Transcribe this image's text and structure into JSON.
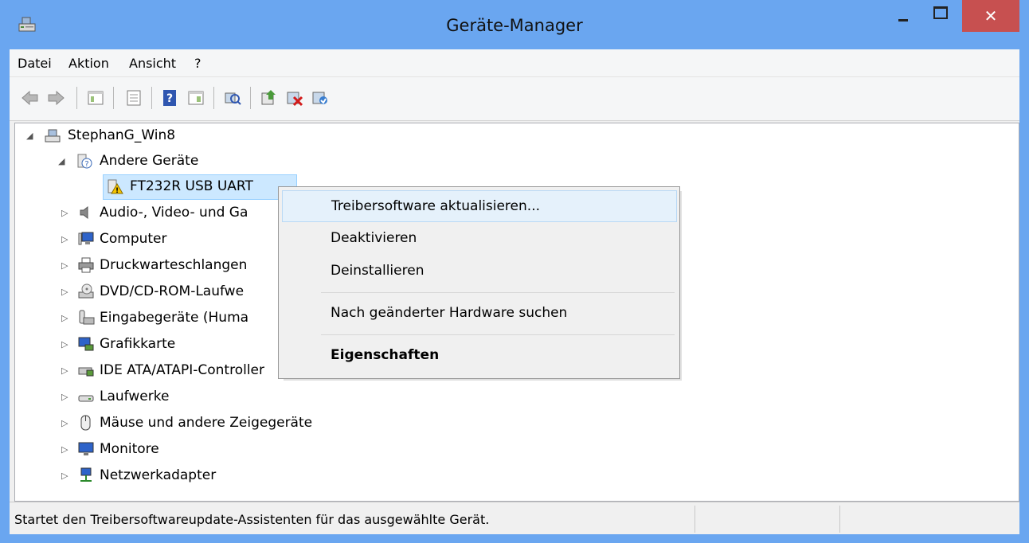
{
  "window": {
    "title": "Geräte-Manager",
    "minimize_glyph": "",
    "maximize_glyph": "",
    "close_glyph": "✕"
  },
  "menu": {
    "items": [
      "Datei",
      "Aktion",
      "Ansicht",
      "?"
    ]
  },
  "tree": {
    "root": "StephanG_Win8",
    "items": [
      {
        "label": "Andere Geräte",
        "icon": "unknown-device-icon",
        "expanded": true
      },
      {
        "label": "FT232R USB UART",
        "icon": "warning-device-icon",
        "selected": true
      },
      {
        "label": "Audio-, Video- und Ga",
        "icon": "speaker-icon"
      },
      {
        "label": "Computer",
        "icon": "computer-icon"
      },
      {
        "label": "Druckwarteschlangen",
        "icon": "printer-icon"
      },
      {
        "label": "DVD/CD-ROM-Laufwe",
        "icon": "dvd-drive-icon"
      },
      {
        "label": "Eingabegeräte (Huma",
        "icon": "input-device-icon"
      },
      {
        "label": "Grafikkarte",
        "icon": "display-adapter-icon"
      },
      {
        "label": "IDE ATA/ATAPI-Controller",
        "icon": "ide-controller-icon"
      },
      {
        "label": "Laufwerke",
        "icon": "disk-drive-icon"
      },
      {
        "label": "Mäuse und andere Zeigegeräte",
        "icon": "mouse-icon"
      },
      {
        "label": "Monitore",
        "icon": "monitor-icon"
      },
      {
        "label": "Netzwerkadapter",
        "icon": "network-adapter-icon"
      }
    ]
  },
  "context_menu": {
    "items": [
      {
        "label": "Treibersoftware aktualisieren...",
        "highlighted": true
      },
      {
        "label": "Deaktivieren"
      },
      {
        "label": "Deinstallieren"
      },
      {
        "label": "Nach geänderter Hardware suchen"
      },
      {
        "label": "Eigenschaften",
        "bold": true
      }
    ]
  },
  "status": {
    "text": "Startet den Treibersoftwareupdate-Assistenten für das ausgewählte Gerät."
  },
  "colors": {
    "titlebar": "#6aa6f0",
    "close_button": "#c75050",
    "selection": "#cce8ff",
    "menu_highlight": "#e5f1fb"
  }
}
